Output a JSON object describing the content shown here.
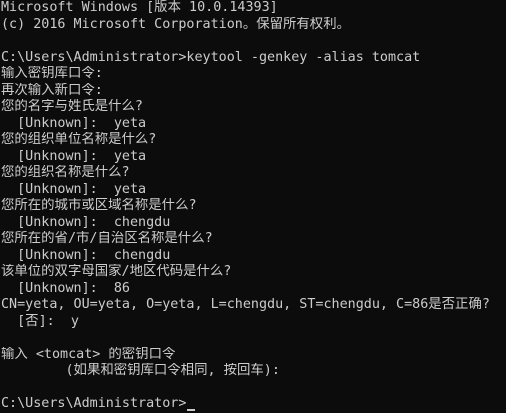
{
  "console": {
    "lines": [
      "Microsoft Windows [版本 10.0.14393]",
      "(c) 2016 Microsoft Corporation。保留所有权利。",
      "",
      "C:\\Users\\Administrator>keytool -genkey -alias tomcat",
      "输入密钥库口令:",
      "再次输入新口令:",
      "您的名字与姓氏是什么?",
      "  [Unknown]:  yeta",
      "您的组织单位名称是什么?",
      "  [Unknown]:  yeta",
      "您的组织名称是什么?",
      "  [Unknown]:  yeta",
      "您所在的城市或区域名称是什么?",
      "  [Unknown]:  chengdu",
      "您所在的省/市/自治区名称是什么?",
      "  [Unknown]:  chengdu",
      "该单位的双字母国家/地区代码是什么?",
      "  [Unknown]:  86",
      "CN=yeta, OU=yeta, O=yeta, L=chengdu, ST=chengdu, C=86是否正确?",
      "  [否]:  y",
      "",
      "输入 <tomcat> 的密钥口令",
      "        (如果和密钥库口令相同, 按回车):",
      ""
    ],
    "prompt": "C:\\Users\\Administrator>"
  },
  "colors": {
    "background": "#0c0c0c",
    "text": "#cccccc"
  }
}
